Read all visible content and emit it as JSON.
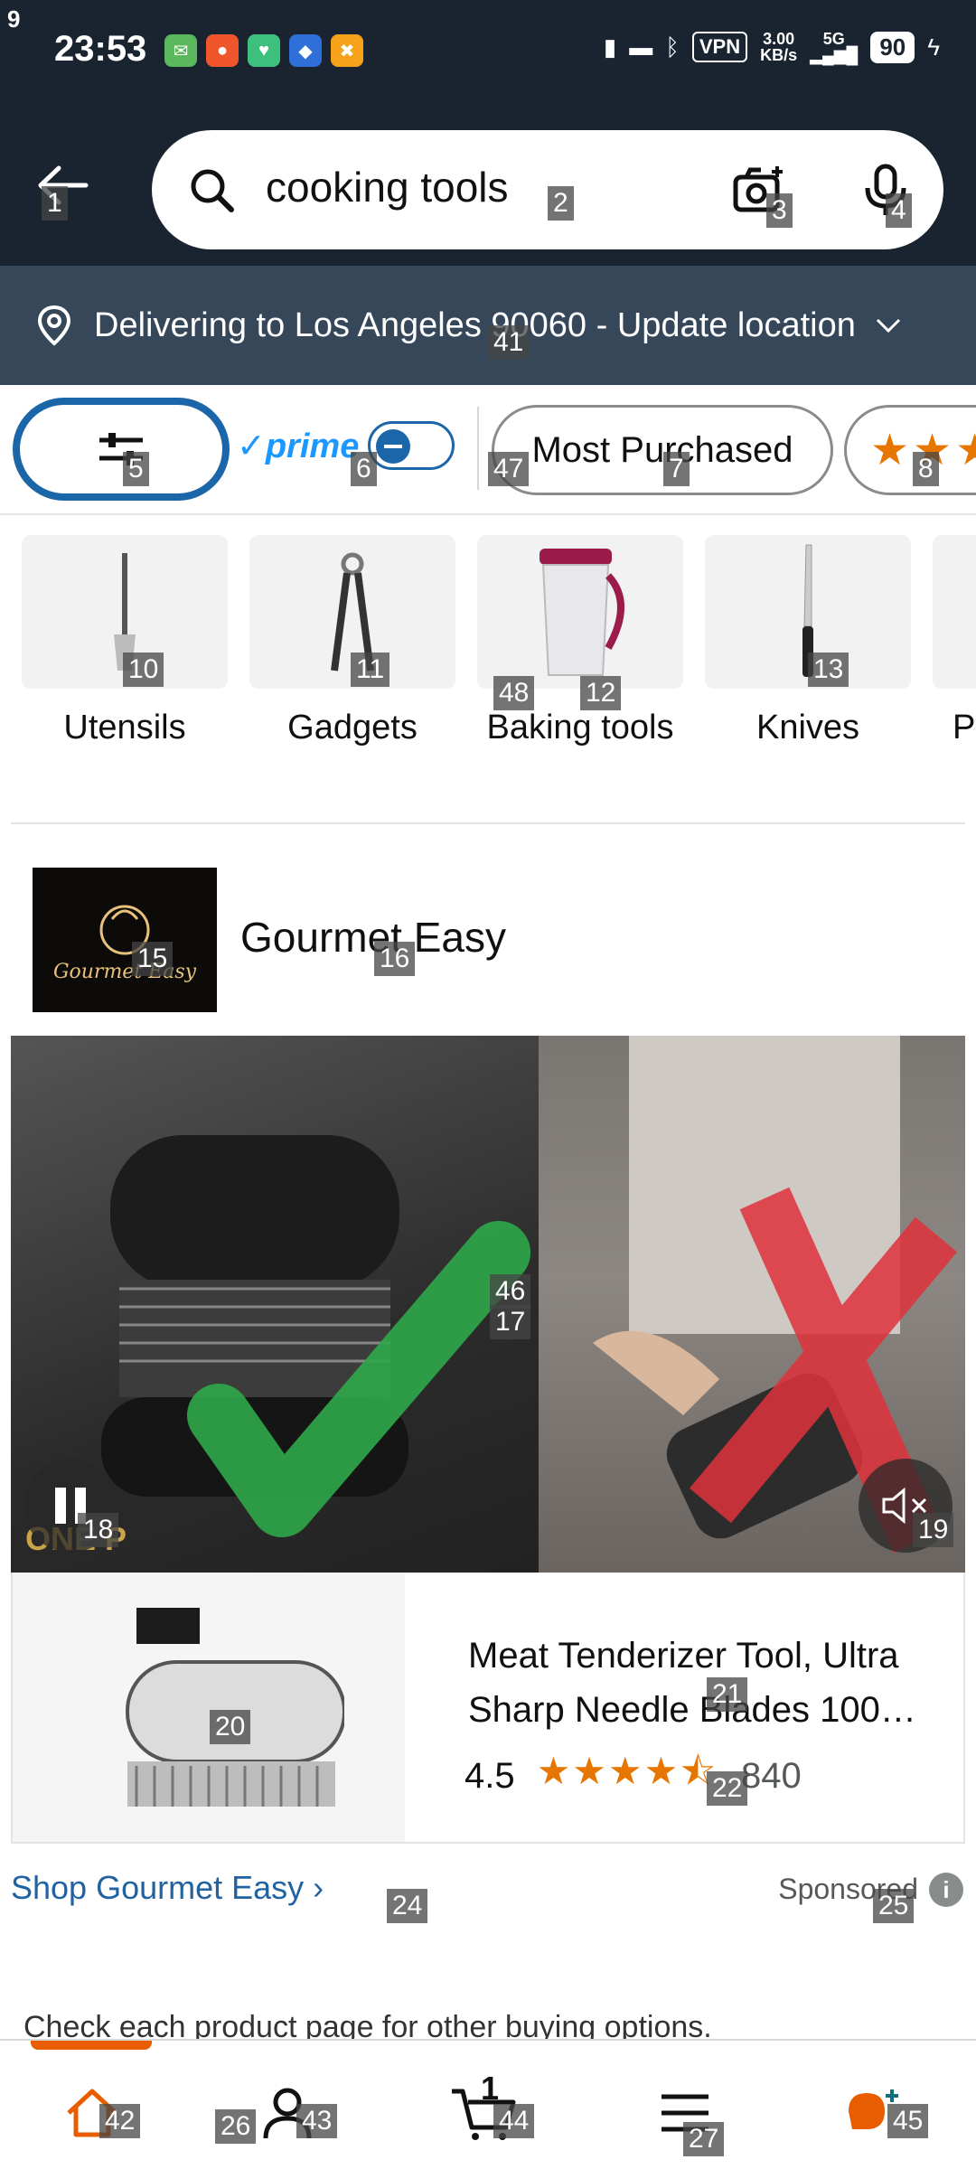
{
  "status_bar": {
    "corner": "9",
    "time": "23:53",
    "vpn": "VPN",
    "net_speed_top": "3.00",
    "net_speed_bottom": "KB/s",
    "net_type": "5G",
    "battery": "90"
  },
  "search": {
    "query": "cooking tools"
  },
  "delivery": {
    "text": "Delivering to Los Angeles 90060 - Update location"
  },
  "filters": {
    "prime_label": "prime",
    "most_purchased": "Most Purchased"
  },
  "categories": [
    {
      "label": "Utensils"
    },
    {
      "label": "Gadgets"
    },
    {
      "label": "Baking tools"
    },
    {
      "label": "Knives"
    },
    {
      "label": "P"
    }
  ],
  "brand": {
    "logo_text": "Gourmet Easy",
    "name": "Gourmet Easy"
  },
  "video": {
    "watermark": "ONE P"
  },
  "product": {
    "title_line1": "Meat Tenderizer Tool, Ultra",
    "title_line2": "Sharp Needle Blades 100…",
    "rating": "4.5",
    "stars": 4.5,
    "review_count": "840"
  },
  "sponsor": {
    "shop_link": "Shop Gourmet Easy ›",
    "label": "Sponsored"
  },
  "notice": "Check each product page for other buying options.",
  "bottom_nav": {
    "cart_count": "1"
  },
  "tags": [
    "1",
    "2",
    "3",
    "4",
    "5",
    "6",
    "47",
    "7",
    "8",
    "10",
    "11",
    "48",
    "12",
    "13",
    "15",
    "16",
    "46",
    "17",
    "18",
    "19",
    "20",
    "21",
    "22",
    "24",
    "25",
    "41",
    "42",
    "26",
    "43",
    "44",
    "27",
    "45"
  ],
  "colors": {
    "header_bg": "#1a2430",
    "delivery_bg": "#37475a",
    "accent_orange": "#e77600",
    "link_blue": "#2162a1",
    "prime_blue": "#1a98ff"
  }
}
